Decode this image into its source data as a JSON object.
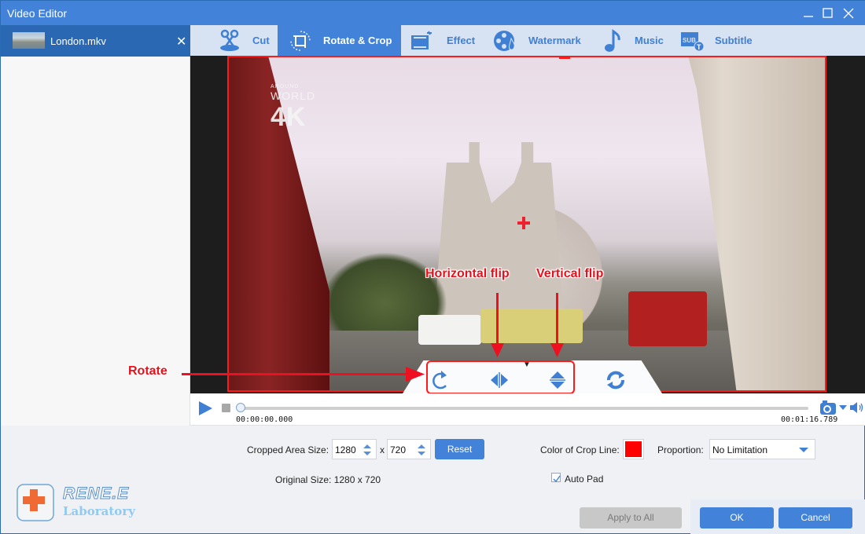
{
  "window": {
    "title": "Video Editor",
    "controls": [
      "minimize-icon",
      "maximize-icon",
      "close-icon"
    ]
  },
  "sidebar": {
    "files": [
      {
        "name": "London.mkv",
        "close_label": "✕"
      }
    ]
  },
  "tabs": [
    {
      "label": "Cut",
      "icon": "scissors-icon",
      "active": false
    },
    {
      "label": "Rotate & Crop",
      "icon": "rotate-crop-icon",
      "active": true
    },
    {
      "label": "Effect",
      "icon": "effect-film-icon",
      "active": false
    },
    {
      "label": "Watermark",
      "icon": "watermark-reel-icon",
      "active": false
    },
    {
      "label": "Music",
      "icon": "music-note-icon",
      "active": false
    },
    {
      "label": "Subtitle",
      "icon": "subtitle-icon",
      "active": false
    }
  ],
  "video": {
    "watermark_small": "AROUND",
    "watermark_mid": "WORLD",
    "watermark_big": "4K"
  },
  "annotations": {
    "rotate": "Rotate",
    "horizontal_flip": "Horizontal flip",
    "vertical_flip": "Vertical flip"
  },
  "controls": [
    "rotate-icon",
    "horizontal-flip-icon",
    "vertical-flip-icon",
    "reset-rotation-icon"
  ],
  "playback": {
    "current_time": "00:00:00.000",
    "end_time": "00:01:16.789",
    "progress": 0
  },
  "settings": {
    "cropped_area_label": "Cropped Area Size:",
    "width_value": "1280",
    "x_label": "x",
    "height_value": "720",
    "reset_label": "Reset",
    "original_size_label": "Original Size: 1280 x 720",
    "crop_line_color_label": "Color of Crop Line:",
    "crop_line_color": "#ff0000",
    "proportion_label": "Proportion:",
    "proportion_value": "No Limitation",
    "auto_pad_label": "Auto Pad",
    "auto_pad_checked": true
  },
  "footer": {
    "apply_all_label": "Apply to All",
    "ok_label": "OK",
    "cancel_label": "Cancel"
  },
  "logo": {
    "brand": "RENE.E",
    "sub": "Laboratory"
  },
  "colors": {
    "accent": "#4283d9",
    "crop": "#ff1a1a"
  }
}
